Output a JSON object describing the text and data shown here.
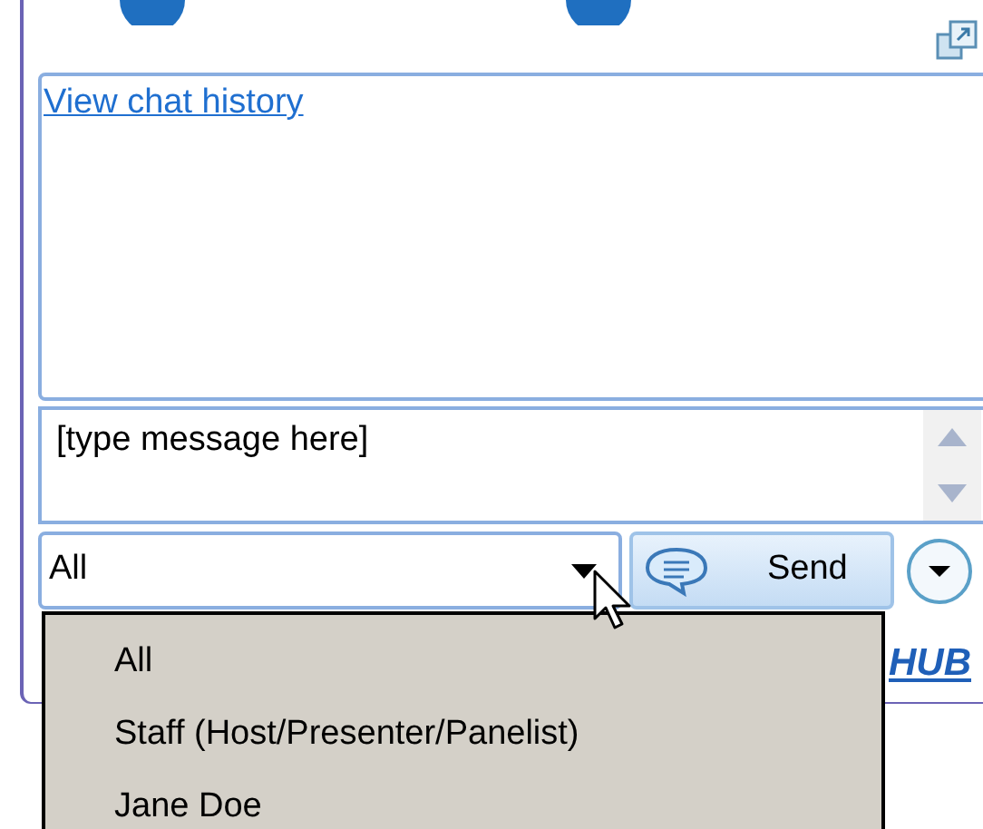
{
  "chat": {
    "history_link": "View chat history"
  },
  "message": {
    "placeholder": "[type message here]"
  },
  "recipient": {
    "value": "All"
  },
  "send_button": {
    "label": "Send"
  },
  "footer_link": "HUB",
  "dropdown": {
    "options": [
      {
        "label": "All",
        "selected": false
      },
      {
        "label": "Staff (Host/Presenter/Panelist)",
        "selected": false
      },
      {
        "label": "Jane Doe",
        "selected": false
      }
    ]
  }
}
